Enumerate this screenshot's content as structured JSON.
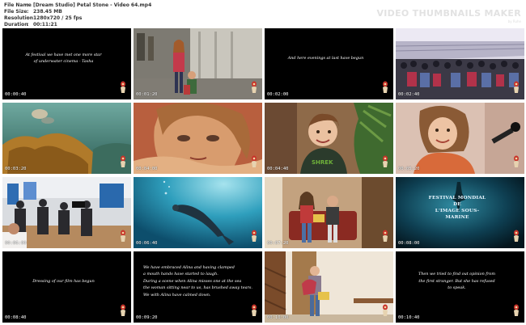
{
  "info": {
    "rows": [
      {
        "label": "File Name",
        "value": "[Dream Studio] Petal Stone - Video 64.mp4"
      },
      {
        "label": "File Size",
        "value": "238.45 MB"
      },
      {
        "label": "Resolution",
        "value": "1280x720 / 25 fps"
      },
      {
        "label": "Duration",
        "value": "00:11:21"
      }
    ],
    "separator": ":"
  },
  "brand": {
    "title": "VIDEO THUMBNAILS MAKER",
    "subtitle": "by Ruhe"
  },
  "thumbnails": [
    {
      "timestamp": "00:00:40",
      "scene": "caption",
      "caption": [
        "At festival we have met one more star",
        "of underwater cinema - Tasha"
      ]
    },
    {
      "timestamp": "00:01:20",
      "scene": "street"
    },
    {
      "timestamp": "00:02:00",
      "scene": "caption",
      "caption": [
        "And here evenings at last have begun"
      ]
    },
    {
      "timestamp": "00:02:40",
      "scene": "stadium"
    },
    {
      "timestamp": "00:03:20",
      "scene": "reef"
    },
    {
      "timestamp": "00:04:00",
      "scene": "girl-face"
    },
    {
      "timestamp": "00:04:40",
      "scene": "boy"
    },
    {
      "timestamp": "00:05:20",
      "scene": "girl-mic"
    },
    {
      "timestamp": "00:06:00",
      "scene": "crowd"
    },
    {
      "timestamp": "00:06:40",
      "scene": "diver"
    },
    {
      "timestamp": "00:07:20",
      "scene": "couch"
    },
    {
      "timestamp": "00:08:00",
      "scene": "festival",
      "festival_text": [
        "FESTIVAL MONDIAL",
        "DE",
        "L'IMAGE SOUS-MARINE"
      ]
    },
    {
      "timestamp": "00:08:40",
      "scene": "caption",
      "caption": [
        "Dressing of our film has begun"
      ]
    },
    {
      "timestamp": "00:09:20",
      "scene": "caption-left",
      "caption": [
        "We have embraced Alina and having clamped",
        "a mouth hands have started to laugh.",
        "During a scene when Alina misses one at the sea",
        "the woman sitting near to us, has brushed away tears.",
        "We with Alina have calmed down."
      ]
    },
    {
      "timestamp": "00:10:00",
      "scene": "hallway"
    },
    {
      "timestamp": "00:10:40",
      "scene": "caption",
      "caption": [
        "Then we tried to find out opinion from",
        "the first stranger. But she has refused",
        "to speak."
      ]
    }
  ]
}
